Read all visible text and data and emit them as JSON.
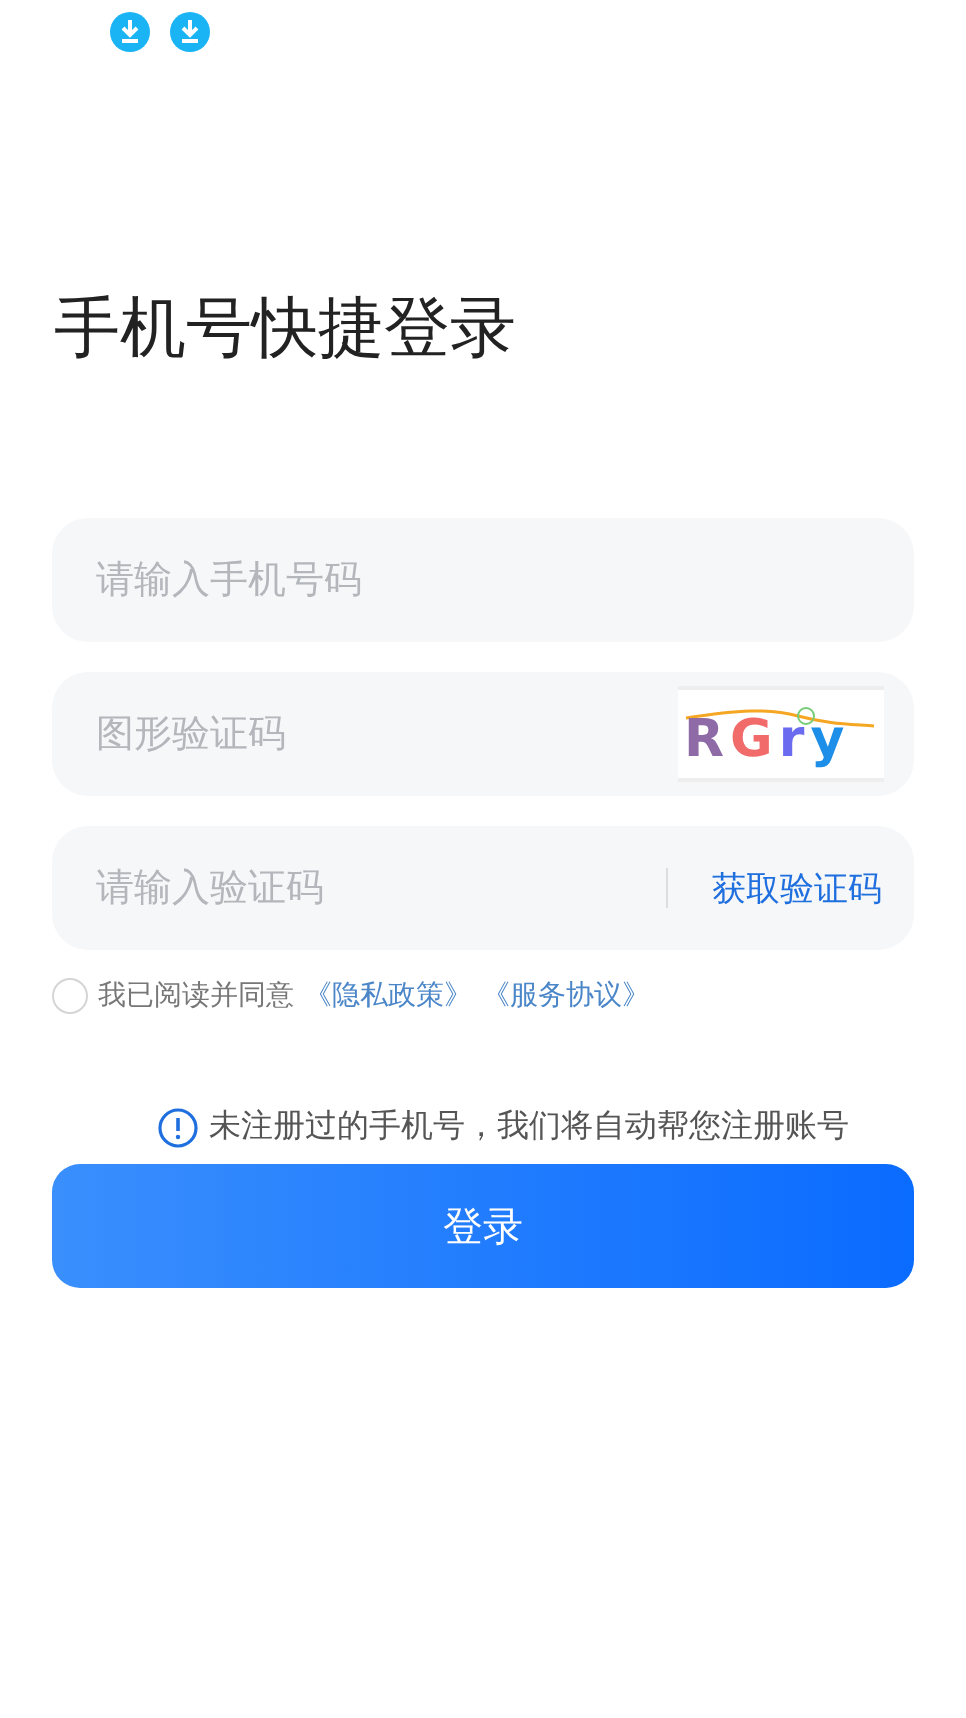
{
  "status_bar": {
    "notifications": [
      {
        "kind": "download"
      },
      {
        "kind": "download"
      }
    ]
  },
  "title": "手机号快捷登录",
  "fields": [
    {
      "kind": "text",
      "placeholder": "请输入手机号码"
    },
    {
      "kind": "captcha",
      "placeholder": "图形验证码",
      "captcha": [
        {
          "char": "R",
          "color": "#8e6aa6"
        },
        {
          "char": "G",
          "color": "#f26b6b"
        },
        {
          "char": "r",
          "color": "#6b6bf0"
        },
        {
          "char": "y",
          "color": "#1e8fe8"
        }
      ]
    },
    {
      "kind": "code",
      "placeholder": "请输入验证码",
      "action": "获取验证码"
    }
  ],
  "agreement": {
    "checked": false,
    "text": "我已阅读并同意",
    "links": [
      "《隐私政策》",
      "《服务协议》"
    ]
  },
  "notice": "未注册过的手机号，我们将自动帮您注册账号",
  "login_button": "登录"
}
